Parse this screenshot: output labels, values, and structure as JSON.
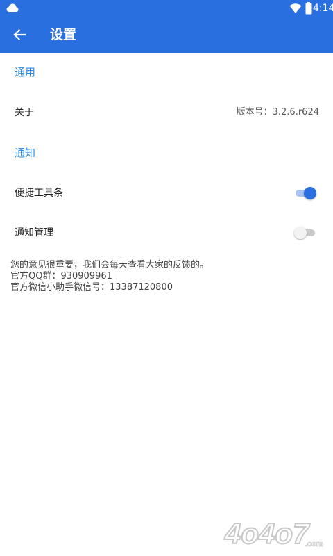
{
  "status_bar": {
    "time": "4:14",
    "left_icon": "cloud-icon",
    "wifi_icon": "wifi-icon",
    "battery_icon": "battery-icon"
  },
  "app_bar": {
    "title": "设置",
    "back_icon": "arrow-left-icon",
    "background_color": "#2a6fe0"
  },
  "sections": [
    {
      "header": "通用",
      "rows": [
        {
          "label": "关于",
          "value": "版本号：3.2.6.r624"
        }
      ]
    },
    {
      "header": "通知",
      "rows": [
        {
          "label": "便捷工具条",
          "switch_on": true
        },
        {
          "label": "通知管理",
          "switch_on": false
        }
      ]
    }
  ],
  "footer": {
    "line1": "您的意见很重要，我们会每天查看大家的反馈的。",
    "line2": "官方QQ群：930909961",
    "line3": "官方微信小助手微信号：13387120800"
  },
  "watermark": {
    "text": "4o4o7",
    "suffix": ".com"
  },
  "colors": {
    "accent": "#2a6fe0",
    "section_header": "#2a8be0"
  }
}
